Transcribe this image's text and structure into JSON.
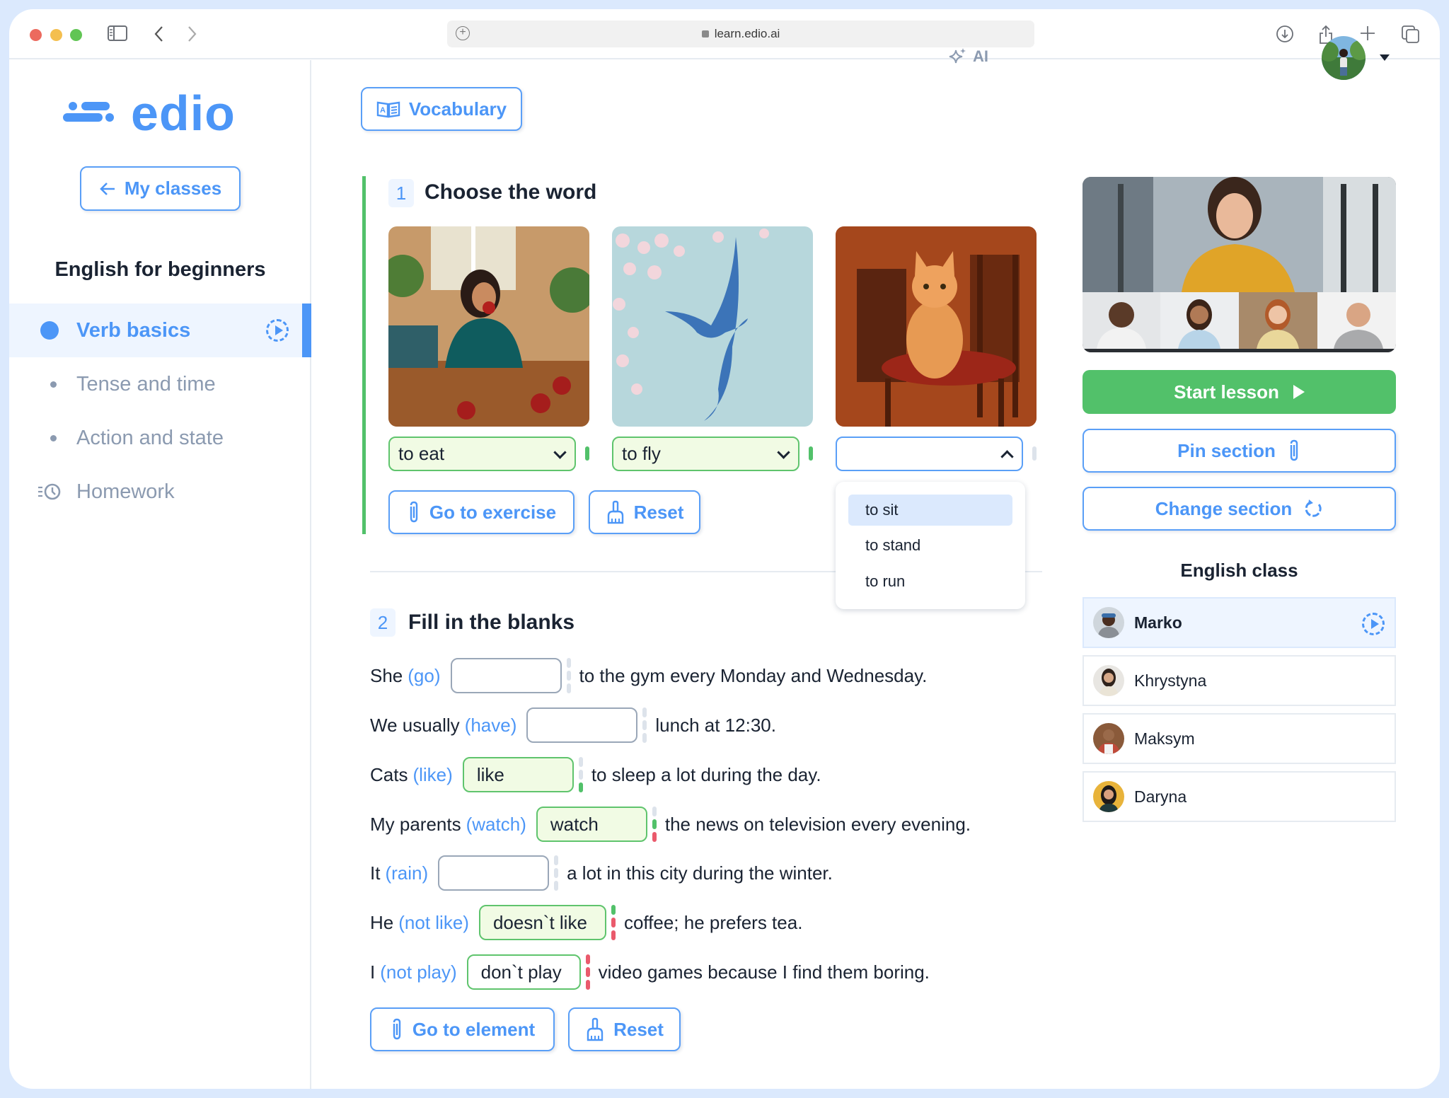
{
  "browser": {
    "url": "learn.edio.ai",
    "icons": [
      "sidebar-toggle-icon",
      "back-icon",
      "forward-icon",
      "new-tab-plus-icon",
      "download-icon",
      "share-icon",
      "add-tab-icon",
      "tabs-overview-icon"
    ]
  },
  "sidebar": {
    "logo": "edio",
    "back_button": "My classes",
    "course_title": "English for beginners",
    "items": [
      {
        "label": "Verb basics",
        "active": true
      },
      {
        "label": "Tense and time",
        "active": false
      },
      {
        "label": "Action and state",
        "active": false
      },
      {
        "label": "Homework",
        "active": false
      }
    ]
  },
  "header": {
    "vocabulary_button": "Vocabulary",
    "ai_label": "AI"
  },
  "exercise1": {
    "number": "1",
    "title": "Choose the word",
    "cards": [
      {
        "image": "woman eating apple",
        "selected": "to eat",
        "status": "correct"
      },
      {
        "image": "blue bird flying",
        "selected": "to fly",
        "status": "correct"
      },
      {
        "image": "cat sitting on chair",
        "selected": "",
        "status": "open"
      }
    ],
    "dropdown_options": [
      "to sit",
      "to stand",
      "to run"
    ],
    "highlighted_option": "to sit",
    "go_button": "Go to exercise",
    "reset_button": "Reset"
  },
  "exercise2": {
    "number": "2",
    "title": "Fill in the blanks",
    "rows": [
      {
        "before": "She",
        "hint": "(go)",
        "value": "",
        "after": "to the gym every Monday and Wednesday."
      },
      {
        "before": "We usually",
        "hint": "(have)",
        "value": "",
        "after": "lunch at 12:30."
      },
      {
        "before": "Cats",
        "hint": "(like)",
        "value": "like",
        "after": "to sleep a lot during the day."
      },
      {
        "before": "My parents",
        "hint": "(watch)",
        "value": "watch",
        "after": "the news on television every evening."
      },
      {
        "before": "It",
        "hint": "(rain)",
        "value": "",
        "after": "a lot in this city during the winter."
      },
      {
        "before": "He",
        "hint": "(not like)",
        "value": "doesn`t like",
        "after": "coffee; he prefers tea."
      },
      {
        "before": "I",
        "hint": "(not play)",
        "value": "don`t play",
        "after": "video games because I find them boring."
      }
    ],
    "go_button": "Go to element",
    "reset_button": "Reset"
  },
  "right_panel": {
    "start_button": "Start lesson",
    "pin_button": "Pin section",
    "change_button": "Change section",
    "class_title": "English class",
    "students": [
      {
        "name": "Marko",
        "active": true
      },
      {
        "name": "Khrystyna",
        "active": false
      },
      {
        "name": "Maksym",
        "active": false
      },
      {
        "name": "Daryna",
        "active": false
      }
    ]
  },
  "colors": {
    "accent": "#4c96f7",
    "success": "#52c16a",
    "error": "#ea5a6c",
    "muted": "#8b9ab0"
  }
}
